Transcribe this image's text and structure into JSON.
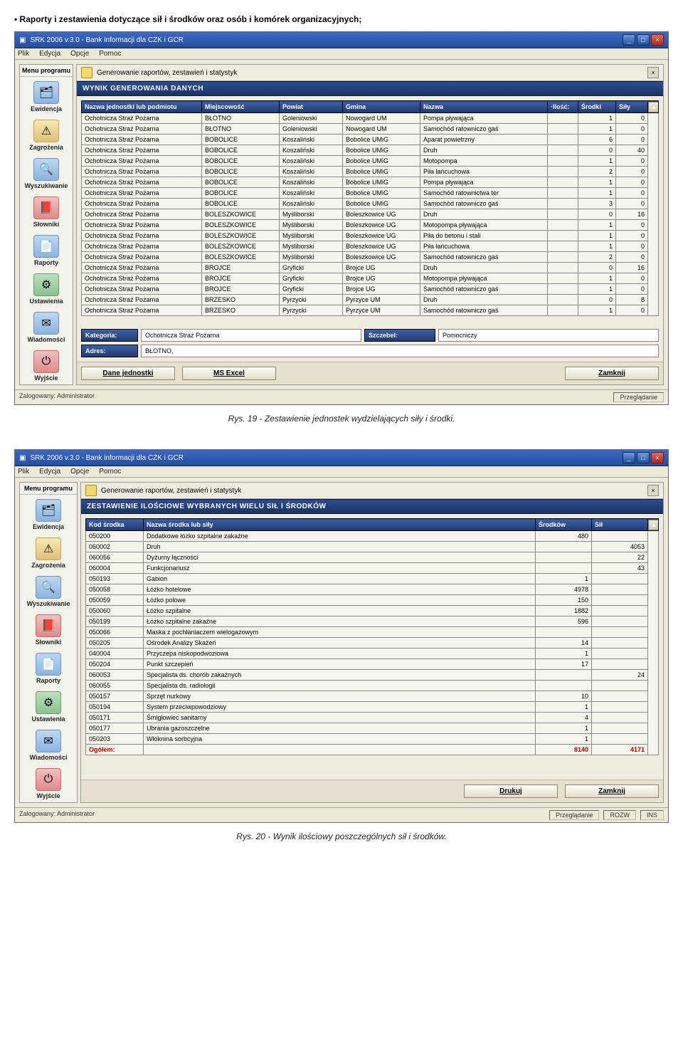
{
  "intro": "Raporty i zestawienia dotyczące sił i środków oraz osób i komórek organizacyjnych;",
  "caption1": "Rys. 19 - Zestawienie jednostek wydzielających siły i środki.",
  "caption2": "Rys. 20 - Wynik ilościowy poszczególnych sił i środków.",
  "app_title": "SRK 2006 v.3.0 - Bank informacji dla CZK i GCR",
  "menu": {
    "plik": "Plik",
    "edycja": "Edycja",
    "opcje": "Opcje",
    "pomoc": "Pomoc"
  },
  "sidebar": {
    "title": "Menu programu",
    "items": [
      {
        "label": "Ewidencja"
      },
      {
        "label": "Zagrożenia"
      },
      {
        "label": "Wyszukiwanie"
      },
      {
        "label": "Słowniki"
      },
      {
        "label": "Raporty"
      },
      {
        "label": "Ustawienia"
      },
      {
        "label": "Wiadomości"
      }
    ],
    "exit": "Wyjście"
  },
  "fig1": {
    "tab": "Generowanie raportów, zestawień i statystyk",
    "banner": "WYNIK GENEROWANIA DANYCH",
    "headers": [
      "Nazwa jednostki lub podmiotu",
      "Miejscowość",
      "Powiat",
      "Gmina",
      "Nazwa",
      "·Ilość:",
      "Środki",
      "Siły"
    ],
    "rows": [
      [
        "Ochotnicza Straż Pożarna",
        "BŁOTNO",
        "Goleniowski",
        "Nowogard UM",
        "Pompa pływająca",
        "",
        "1",
        "0"
      ],
      [
        "Ochotnicza Straż Pożarna",
        "BŁOTNO",
        "Goleniowski",
        "Nowogard UM",
        "Samochód ratowniczo gaś",
        "",
        "1",
        "0"
      ],
      [
        "Ochotnicza Straż Pożarna",
        "BOBOLICE",
        "Koszaliński",
        "Bobolice UMiG",
        "Aparat powietrzny",
        "",
        "6",
        "0"
      ],
      [
        "Ochotnicza Straż Pożarna",
        "BOBOLICE",
        "Koszaliński",
        "Bobolice UMiG",
        "Druh",
        "",
        "0",
        "40"
      ],
      [
        "Ochotnicza Straż Pożarna",
        "BOBOLICE",
        "Koszaliński",
        "Bobolice UMiG",
        "Motopompa",
        "",
        "1",
        "0"
      ],
      [
        "Ochotnicza Straż Pożarna",
        "BOBOLICE",
        "Koszaliński",
        "Bobolice UMiG",
        "Piła łańcuchowa",
        "",
        "2",
        "0"
      ],
      [
        "Ochotnicza Straż Pożarna",
        "BOBOLICE",
        "Koszaliński",
        "Bobolice UMiG",
        "Pompa pływająca",
        "",
        "1",
        "0"
      ],
      [
        "Ochotnicza Straż Pożarna",
        "BOBOLICE",
        "Koszaliński",
        "Bobolice UMiG",
        "Samochód ratownictwa ter",
        "",
        "1",
        "0"
      ],
      [
        "Ochotnicza Straż Pożarna",
        "BOBOLICE",
        "Koszaliński",
        "Bobolice UMiG",
        "Samochód ratowniczo gaś",
        "",
        "3",
        "0"
      ],
      [
        "Ochotnicza Straż Pożarna",
        "BOLESZKOWICE",
        "Myśliborski",
        "Boleszkowice UG",
        "Druh",
        "",
        "0",
        "16"
      ],
      [
        "Ochotnicza Straż Pożarna",
        "BOLESZKOWICE",
        "Myśliborski",
        "Boleszkowice UG",
        "Motopompa pływająca",
        "",
        "1",
        "0"
      ],
      [
        "Ochotnicza Straż Pożarna",
        "BOLESZKOWICE",
        "Myśliborski",
        "Boleszkowice UG",
        "Piła do betonu i stali",
        "",
        "1",
        "0"
      ],
      [
        "Ochotnicza Straż Pożarna",
        "BOLESZKOWICE",
        "Myśliborski",
        "Boleszkowice UG",
        "Piła łańcuchowa",
        "",
        "1",
        "0"
      ],
      [
        "Ochotnicza Straż Pożarna",
        "BOLESZKOWICE",
        "Myśliborski",
        "Boleszkowice UG",
        "Samochód ratowniczo gaś",
        "",
        "2",
        "0"
      ],
      [
        "Ochotnicza Straż Pożarna",
        "BROJCE",
        "Gryficki",
        "Brojce UG",
        "Druh",
        "",
        "0",
        "16"
      ],
      [
        "Ochotnicza Straż Pożarna",
        "BROJCE",
        "Gryficki",
        "Brojce UG",
        "Motopompa pływająca",
        "",
        "1",
        "0"
      ],
      [
        "Ochotnicza Straż Pożarna",
        "BROJCE",
        "Gryficki",
        "Brojce UG",
        "Samochód ratowniczo gaś",
        "",
        "1",
        "0"
      ],
      [
        "Ochotnicza Straż Pożarna",
        "BRZESKO",
        "Pyrzycki",
        "Pyrzyce UM",
        "Druh",
        "",
        "0",
        "8"
      ],
      [
        "Ochotnicza Straż Pożarna",
        "BRZESKO",
        "Pyrzycki",
        "Pyrzyce UM",
        "Samochód ratowniczo gaś",
        "",
        "1",
        "0"
      ]
    ],
    "strip": {
      "kategoria_lbl": "Kategoria:",
      "kategoria_val": "Ochotnicza Straż Pożarna",
      "szczebel_lbl": "Szczebel:",
      "szczebel_val": "Pomocniczy",
      "adres_lbl": "Adres:",
      "adres_val": "BŁOTNO,"
    },
    "buttons": {
      "dane": "Dane jednostki",
      "excel": "MS Excel",
      "zamknij": "Zamknij"
    },
    "status": {
      "left": "Zalogowany: Administrator",
      "right": [
        "Przeglądanie"
      ]
    }
  },
  "fig2": {
    "tab": "Generowanie raportów, zestawień i statystyk",
    "banner": "ZESTAWIENIE ILOŚCIOWE WYBRANYCH WIELU SIŁ I ŚRODKÓW",
    "headers": [
      "Kod środka",
      "Nazwa środka lub siły",
      "Środków",
      "Sił"
    ],
    "rows": [
      [
        "050200",
        "Dodatkowe łóżko szpitalne zakaźne",
        "480",
        ""
      ],
      [
        "060002",
        "Druh",
        "",
        "4053"
      ],
      [
        "060056",
        "Dyżurny łączności",
        "",
        "22"
      ],
      [
        "060004",
        "Funkcjonariusz",
        "",
        "43"
      ],
      [
        "050193",
        "Gabion",
        "1",
        ""
      ],
      [
        "050058",
        "Łóżko hotelowe",
        "4978",
        ""
      ],
      [
        "050059",
        "Łóżko polowe",
        "150",
        ""
      ],
      [
        "050060",
        "Łóżko szpitalne",
        "1882",
        ""
      ],
      [
        "050199",
        "Łóżko szpitalne zakaźne",
        "596",
        ""
      ],
      [
        "050066",
        "Maska z pochłaniaczem wielogazowym",
        "",
        ""
      ],
      [
        "050205",
        "Ośrodek Analizy Skażeń",
        "14",
        ""
      ],
      [
        "040004",
        "Przyczepa niskopodwoziowa",
        "1",
        ""
      ],
      [
        "050204",
        "Punkt szczepień",
        "17",
        ""
      ],
      [
        "060053",
        "Specjalista ds. chorób zakaźnych",
        "",
        "24"
      ],
      [
        "060055",
        "Specjalista ds. radiologii",
        "",
        ""
      ],
      [
        "050157",
        "Sprzęt nurkowy",
        "10",
        ""
      ],
      [
        "050194",
        "System przeciwpowodziowy",
        "1",
        ""
      ],
      [
        "050171",
        "Śmigłowiec sanitarny",
        "4",
        ""
      ],
      [
        "050177",
        "Ubrania gazoszczelne",
        "1",
        ""
      ],
      [
        "050203",
        "Włóknina sorbcyjna",
        "1",
        ""
      ]
    ],
    "total": {
      "label": "Ogółem:",
      "srodkow": "8140",
      "sil": "4171"
    },
    "buttons": {
      "drukuj": "Drukuj",
      "zamknij": "Zamknij"
    },
    "status": {
      "left": "Zalogowany: Administrator",
      "right": [
        "Przeglądanie",
        "ROZW",
        "INS"
      ]
    }
  }
}
